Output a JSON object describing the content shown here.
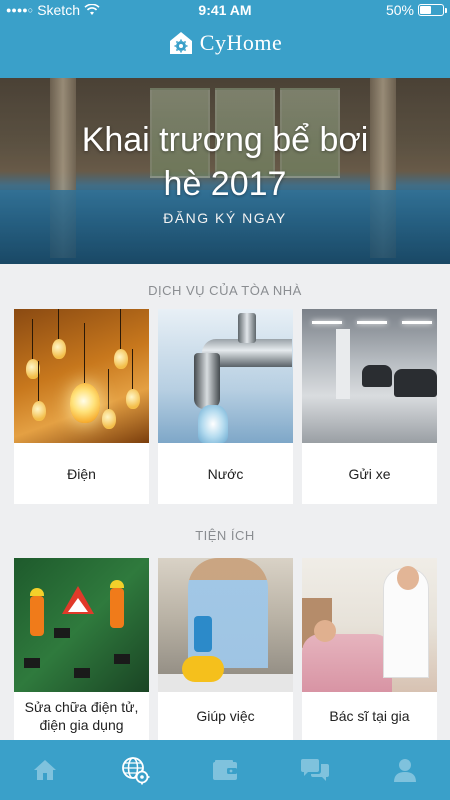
{
  "status_bar": {
    "carrier": "Sketch",
    "time": "9:41 AM",
    "battery": "50%",
    "battery_level": 0.5
  },
  "header": {
    "brand": "CyHome",
    "logo_icon": "house-gear-icon"
  },
  "banner": {
    "title_line1": "Khai trương bể bơi",
    "title_line2": "hè 2017",
    "cta": "ĐĂNG KÝ NGAY"
  },
  "services": {
    "title": "DỊCH VỤ CỦA TÒA NHÀ",
    "items": [
      {
        "label": "Điện",
        "image": "light-bulbs"
      },
      {
        "label": "Nước",
        "image": "water-tap"
      },
      {
        "label": "Gửi xe",
        "image": "parking-garage"
      }
    ]
  },
  "utilities": {
    "title": "TIỆN ÍCH",
    "items": [
      {
        "label": "Sửa chữa điện tử, điện gia dụng",
        "image": "electronics-repair"
      },
      {
        "label": "Giúp việc",
        "image": "house-cleaning"
      },
      {
        "label": "Bác sĩ tại gia",
        "image": "home-doctor"
      }
    ]
  },
  "tabbar": {
    "active": 1,
    "tabs": [
      "home-icon",
      "globe-gear-icon",
      "wallet-icon",
      "chat-icon",
      "user-icon"
    ]
  },
  "colors": {
    "primary": "#3aa0c9",
    "icon_inactive": "#7fc2dd",
    "background": "#eeeff1"
  }
}
